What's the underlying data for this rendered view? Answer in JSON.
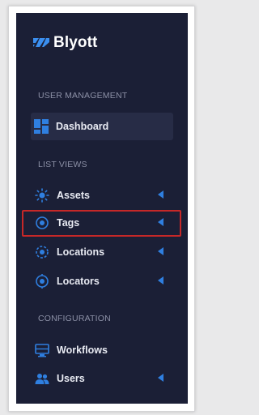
{
  "brand": {
    "name": "Blyott",
    "icon": "blyott-logo-icon"
  },
  "sections": {
    "user_management": "USER MANAGEMENT",
    "list_views": "LIST VIEWS",
    "configuration": "CONFIGURATION"
  },
  "nav": {
    "dashboard": {
      "label": "Dashboard",
      "icon": "dashboard-icon",
      "active": true
    },
    "assets": {
      "label": "Assets",
      "icon": "assets-icon",
      "expandable": true
    },
    "tags": {
      "label": "Tags",
      "icon": "tags-icon",
      "expandable": true,
      "highlighted": true
    },
    "locations": {
      "label": "Locations",
      "icon": "locations-icon",
      "expandable": true
    },
    "locators": {
      "label": "Locators",
      "icon": "locators-icon",
      "expandable": true
    },
    "workflows": {
      "label": "Workflows",
      "icon": "workflows-icon",
      "expandable": false
    },
    "users": {
      "label": "Users",
      "icon": "users-icon",
      "expandable": true
    }
  },
  "colors": {
    "sidebar_bg": "#1b1f36",
    "accent": "#2f7fe0",
    "highlight_border": "#c62828"
  }
}
